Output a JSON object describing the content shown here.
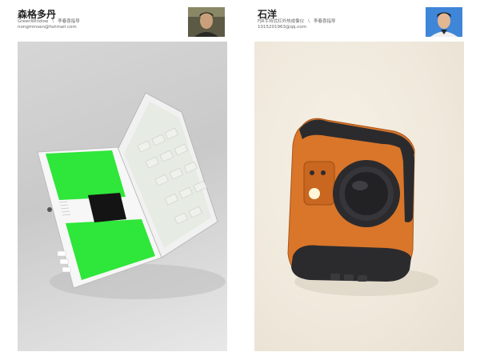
{
  "cards": [
    {
      "name": "森格多丹",
      "project": "GreenWindow",
      "separator": "\\",
      "mentor": "李春喜指导",
      "email": "nongminsen@hotmail.com"
    },
    {
      "name": "石洋",
      "project": "FJR手持式红外热成像仪",
      "separator": "\\",
      "mentor": "李春喜指导",
      "email": "1015201963@qq.com"
    }
  ],
  "colors": {
    "laptop_screen_green": "#2fe63a",
    "camera_body_orange": "#d9762a",
    "camera_grip_black": "#2b2b2e"
  }
}
